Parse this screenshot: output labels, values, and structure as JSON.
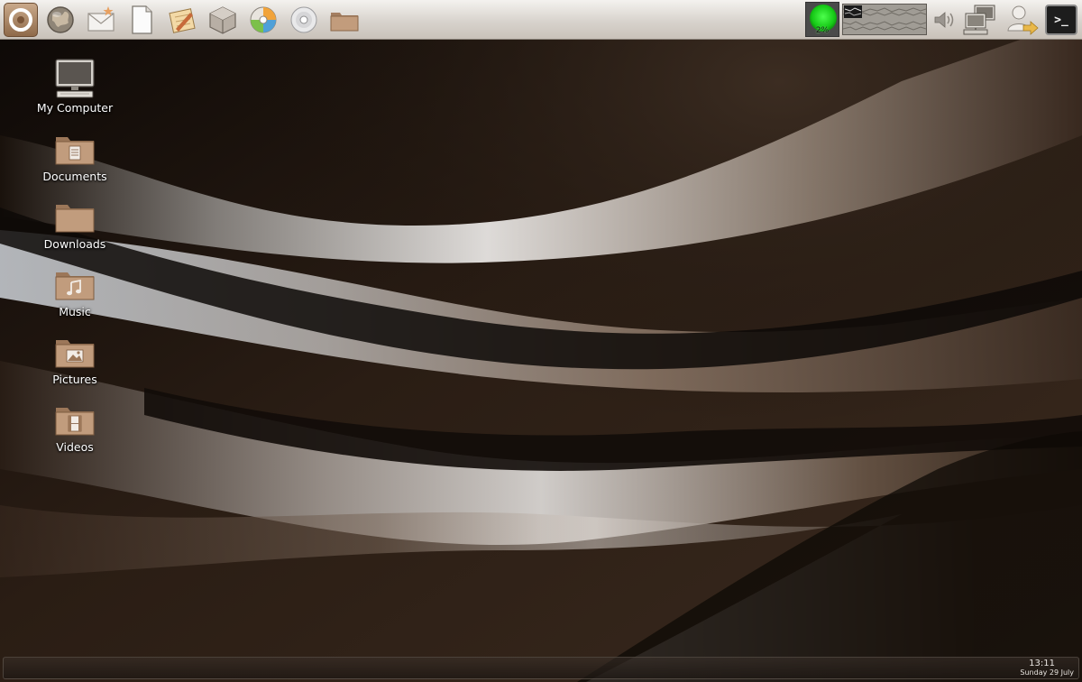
{
  "top_panel": {
    "launchers": [
      {
        "icon": "menu-icon"
      },
      {
        "icon": "web-browser-icon"
      },
      {
        "icon": "mail-icon"
      },
      {
        "icon": "text-document-icon"
      },
      {
        "icon": "notes-editor-icon"
      },
      {
        "icon": "package-manager-icon"
      },
      {
        "icon": "media-player-icon"
      },
      {
        "icon": "disc-burner-icon"
      },
      {
        "icon": "file-manager-icon"
      }
    ],
    "cpu_monitor": {
      "value": "2%",
      "color": "#22dd22"
    },
    "tray": {
      "volume_icon": "speaker-icon",
      "network_icon": "network-computers-icon",
      "user_icon": "user-logout-icon",
      "terminal_label": ">_"
    }
  },
  "desktop": {
    "icons": [
      {
        "label": "My Computer",
        "icon": "computer-icon"
      },
      {
        "label": "Documents",
        "icon": "documents-folder-icon"
      },
      {
        "label": "Downloads",
        "icon": "downloads-folder-icon"
      },
      {
        "label": "Music",
        "icon": "music-folder-icon"
      },
      {
        "label": "Pictures",
        "icon": "pictures-folder-icon"
      },
      {
        "label": "Videos",
        "icon": "videos-folder-icon"
      }
    ]
  },
  "bottom_panel": {
    "clock_time": "13:11",
    "clock_date": "Sunday 29 July"
  },
  "colors": {
    "folder": "#b89274",
    "panel": "#d8d3cd",
    "wallpaper_dark": "#1a120c",
    "wallpaper_light": "#e8e6e4"
  }
}
